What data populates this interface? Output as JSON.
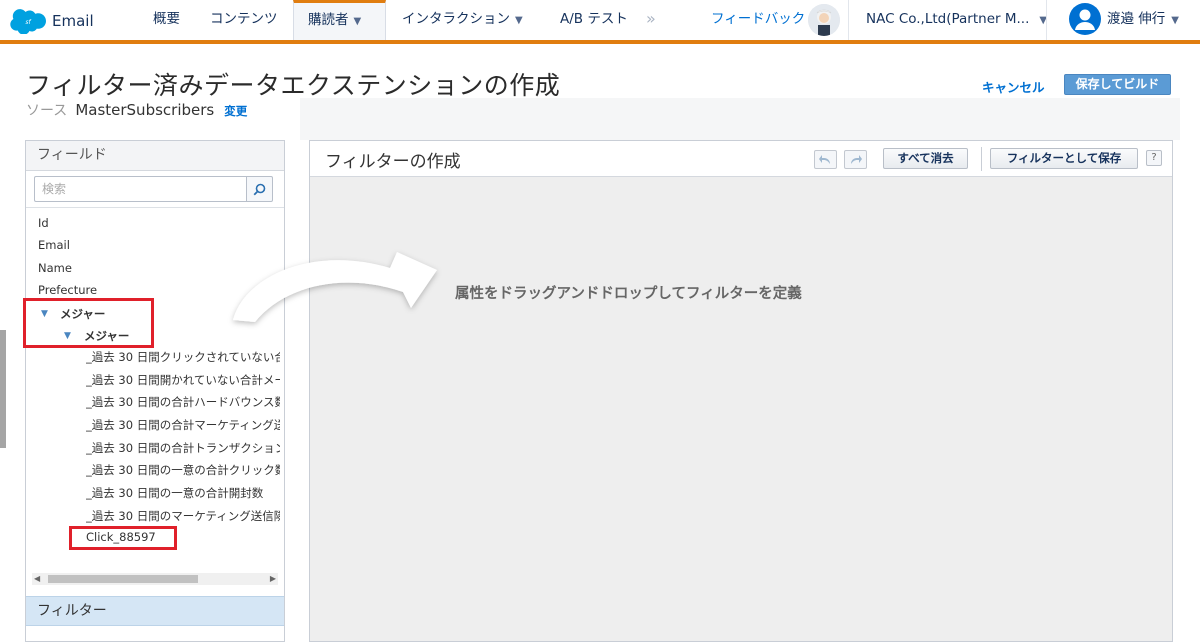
{
  "brand": {
    "name": "Email",
    "logo_icon": "salesforce-cloud-icon",
    "color": "#00a1e0"
  },
  "nav": {
    "items": [
      {
        "label": "概要"
      },
      {
        "label": "コンテンツ"
      },
      {
        "label": "購読者",
        "active": true,
        "has_dropdown": true
      },
      {
        "label": "インタラクション",
        "has_dropdown": true
      },
      {
        "label": "A/B テスト"
      }
    ],
    "more_icon": "double-chevron-right-icon",
    "feedback": "フィードバック",
    "account": "NAC Co.,Ltd(Partner M...",
    "user_name": "渡邉 伸行",
    "accent_color": "#e07d10"
  },
  "page": {
    "title": "フィルター済みデータエクステンションの作成",
    "source_label": "ソース",
    "source_value": "MasterSubscribers",
    "source_change": "変更",
    "cancel": "キャンセル",
    "save_build": "保存してビルド"
  },
  "fields_panel": {
    "header": "フィールド",
    "search_placeholder": "検索",
    "fields": [
      "Id",
      "Email",
      "Name",
      "Prefecture"
    ],
    "group_label": "メジャー",
    "subgroup_label": "メジャー",
    "measures": [
      "_過去 30 日間クリックされていない合",
      "_過去 30 日間開かれていない合計メー",
      "_過去 30 日間の合計ハードバウンス数",
      "_過去 30 日間の合計マーケティング送",
      "_過去 30 日間の合計トランザクション",
      "_過去 30 日間の一意の合計クリック数",
      "_過去 30 日間の一意の合計開封数",
      "_過去 30 日間のマーケティング送信隣"
    ],
    "custom_measure": "Click_88597",
    "filter_header": "フィルター"
  },
  "builder": {
    "title": "フィルターの作成",
    "undo_icon": "undo-icon",
    "redo_icon": "redo-icon",
    "clear_all": "すべて消去",
    "save_as_filter": "フィルターとして保存",
    "help": "?",
    "drop_hint": "属性をドラッグアンドドロップしてフィルターを定義"
  }
}
